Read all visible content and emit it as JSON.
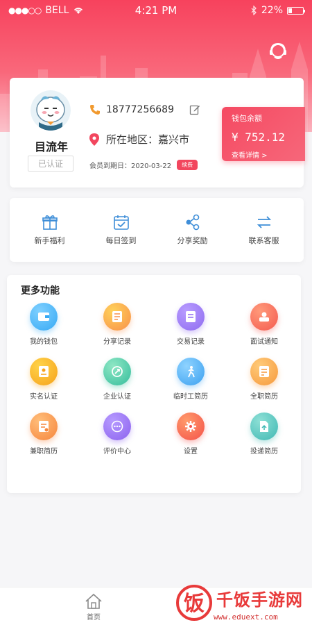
{
  "status_bar": {
    "carrier": "BELL",
    "signal": "●●●○○",
    "time": "4:21 PM",
    "battery": "22%"
  },
  "profile": {
    "name": "目流年",
    "verified": "已认证",
    "phone": "18777256689",
    "region": "所在地区：嘉兴市",
    "member_expiry": "会员到期日：2020-03-22",
    "renew": "续费"
  },
  "wallet": {
    "title": "钱包余额",
    "amount": "¥ 752.12",
    "link": "查看详情 >"
  },
  "quick_actions": [
    {
      "label": "新手福利",
      "icon": "gift-icon"
    },
    {
      "label": "每日签到",
      "icon": "calendar-check-icon"
    },
    {
      "label": "分享奖励",
      "icon": "share-icon"
    },
    {
      "label": "联系客服",
      "icon": "transfer-arrows-icon"
    }
  ],
  "more": {
    "title": "更多功能",
    "items": [
      {
        "label": "我的钱包",
        "icon": "wallet-icon",
        "color": "#36a9f4"
      },
      {
        "label": "分享记录",
        "icon": "share-record-icon",
        "color": "#f8904a"
      },
      {
        "label": "交易记录",
        "icon": "transaction-icon",
        "color": "#8f6cf0"
      },
      {
        "label": "面试通知",
        "icon": "interview-icon",
        "color": "#f45a50"
      },
      {
        "label": "实名认证",
        "icon": "id-verify-icon",
        "color": "#f6a21a"
      },
      {
        "label": "企业认证",
        "icon": "company-verify-icon",
        "color": "#35bd9c"
      },
      {
        "label": "临时工简历",
        "icon": "temp-resume-icon",
        "color": "#3aa0f0"
      },
      {
        "label": "全职简历",
        "icon": "fulltime-resume-icon",
        "color": "#f6993c"
      },
      {
        "label": "兼职简历",
        "icon": "parttime-resume-icon",
        "color": "#f6853c"
      },
      {
        "label": "评价中心",
        "icon": "review-icon",
        "color": "#8c62ee"
      },
      {
        "label": "设置",
        "icon": "settings-icon",
        "color": "#f4514a"
      },
      {
        "label": "投递简历",
        "icon": "submit-resume-icon",
        "color": "#3fb8b3"
      }
    ]
  },
  "tabbar": {
    "home": "首页"
  },
  "watermark": {
    "brand": "千饭手游网",
    "url": "www.eduext.com",
    "mark": "饭"
  },
  "colors": {
    "accent": "#f2465e",
    "icon_blue": "#3e8ed8"
  }
}
